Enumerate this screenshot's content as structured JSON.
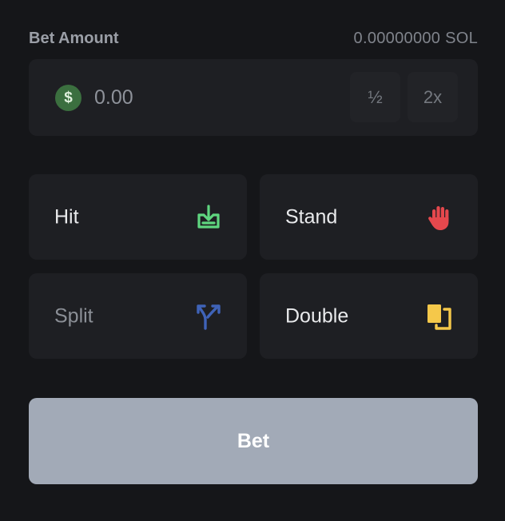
{
  "bet": {
    "label": "Bet Amount",
    "balance": "0.00000000 SOL",
    "amount_placeholder": "0.00",
    "currency_icon": "dollar-coin-icon",
    "currency_glyph": "$",
    "half_label": "½",
    "double_label": "2x"
  },
  "actions": {
    "hit": {
      "label": "Hit",
      "icon": "tray-download-icon",
      "color": "#5fd67f"
    },
    "stand": {
      "label": "Stand",
      "icon": "hand-stop-icon",
      "color": "#e5484d"
    },
    "split": {
      "label": "Split",
      "icon": "split-arrows-icon",
      "color": "#3f63b8",
      "disabled": true
    },
    "double": {
      "label": "Double",
      "icon": "double-cards-icon",
      "color": "#f5c84a"
    }
  },
  "submit": {
    "label": "Bet",
    "color": "#a2aab7"
  }
}
